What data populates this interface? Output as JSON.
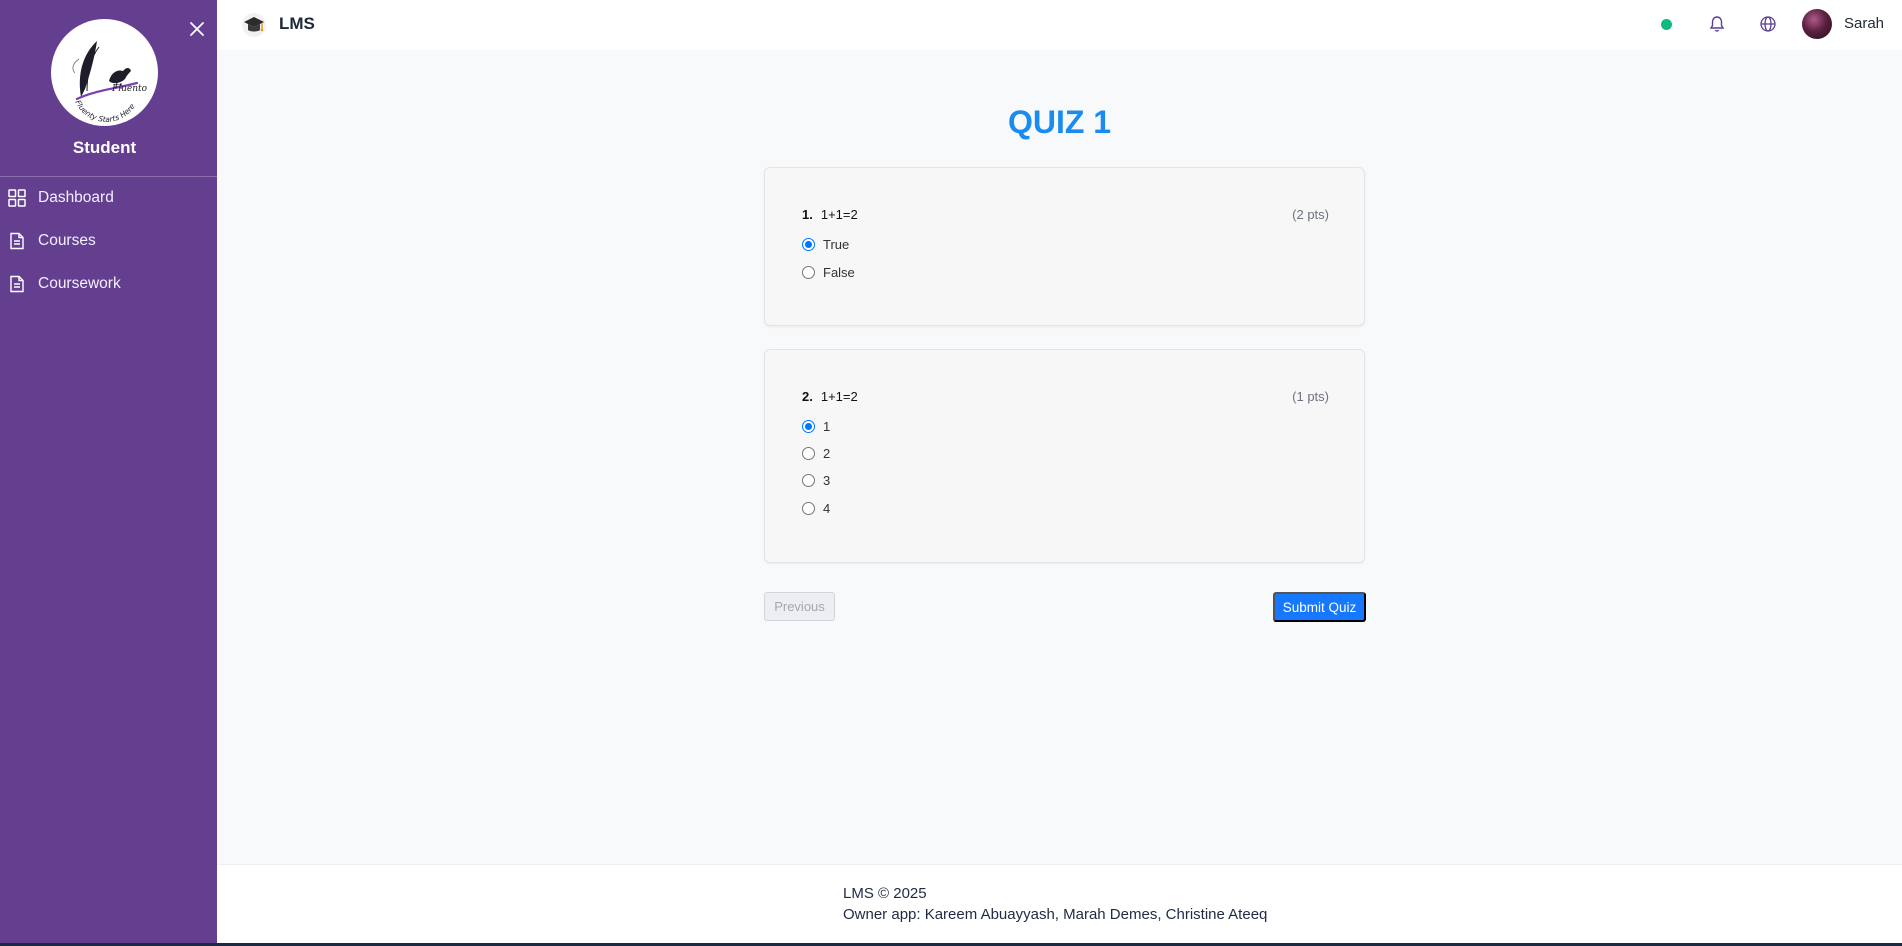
{
  "sidebar": {
    "role": "Student",
    "logo_text": "Fluenty Starts Here",
    "items": [
      {
        "label": "Dashboard",
        "icon": "grid-icon"
      },
      {
        "label": "Courses",
        "icon": "document-icon"
      },
      {
        "label": "Coursework",
        "icon": "document-icon"
      }
    ]
  },
  "topbar": {
    "brand": "LMS",
    "user_name": "Sarah",
    "status_color": "#10b981"
  },
  "quiz": {
    "title": "QUIZ 1",
    "questions": [
      {
        "number": "1.",
        "text": "1+1=2",
        "points": "(2 pts)",
        "options": [
          "True",
          "False"
        ],
        "selected": "True"
      },
      {
        "number": "2.",
        "text": "1+1=2",
        "points": "(1 pts)",
        "options": [
          "1",
          "2",
          "3",
          "4"
        ],
        "selected": "1"
      }
    ],
    "previous_label": "Previous",
    "submit_label": "Submit Quiz"
  },
  "footer": {
    "line1": "LMS © 2025",
    "line2": "Owner app: Kareem Abuayyash, Marah Demes, Christine Ateeq"
  },
  "colors": {
    "sidebar_bg": "#643f90",
    "accent": "#1677ff",
    "title": "#1a8cf0"
  }
}
